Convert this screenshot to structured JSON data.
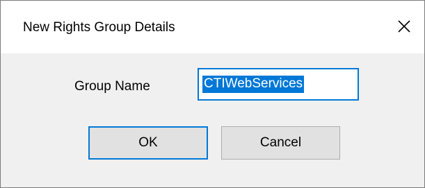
{
  "dialog": {
    "title": "New Rights Group Details",
    "close_icon": "close-icon"
  },
  "form": {
    "group_name_label": "Group Name",
    "group_name_value": "CTIWebServices"
  },
  "buttons": {
    "ok_label": "OK",
    "cancel_label": "Cancel"
  },
  "colors": {
    "accent": "#0078d7",
    "button_bg": "#e1e1e1",
    "dialog_bg": "#f0f0f0"
  }
}
